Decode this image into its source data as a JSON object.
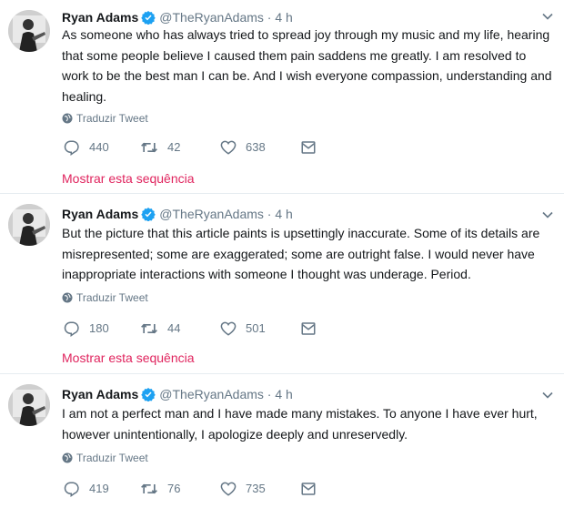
{
  "tweets": [
    {
      "name": "Ryan Adams",
      "handle": "@TheRyanAdams",
      "sep": " · ",
      "time": "4 h",
      "text": "As someone who has always tried to spread joy through my music and my life, hearing that some people believe I caused them pain saddens me greatly. I am resolved to work to be the best man I can be.  And I wish everyone compassion, understanding and healing.",
      "translate": "Traduzir Tweet",
      "replies": "440",
      "retweets": "42",
      "likes": "638",
      "show_thread": "Mostrar esta sequência"
    },
    {
      "name": "Ryan Adams",
      "handle": "@TheRyanAdams",
      "sep": " · ",
      "time": "4 h",
      "text": "But the picture that this article paints is upsettingly inaccurate. Some of its details are misrepresented; some are exaggerated; some are outright false. I would never have inappropriate interactions with someone I thought was underage. Period.",
      "translate": "Traduzir Tweet",
      "replies": "180",
      "retweets": "44",
      "likes": "501",
      "show_thread": "Mostrar esta sequência"
    },
    {
      "name": "Ryan Adams",
      "handle": "@TheRyanAdams",
      "sep": " · ",
      "time": "4 h",
      "text": "I am not a perfect man and I have made many mistakes. To anyone I have ever hurt, however unintentionally, I apologize deeply and unreservedly.",
      "translate": "Traduzir Tweet",
      "replies": "419",
      "retweets": "76",
      "likes": "735"
    }
  ],
  "icons": {
    "verified": "verified-badge-icon",
    "caret": "chevron-down-icon",
    "globe": "globe-icon",
    "reply": "reply-icon",
    "retweet": "retweet-icon",
    "like": "heart-icon",
    "message": "envelope-icon"
  },
  "colors": {
    "text": "#14171a",
    "secondary": "#657786",
    "verified": "#1da1f2",
    "show_thread": "#e0245e",
    "divider": "#e6ecf0"
  }
}
